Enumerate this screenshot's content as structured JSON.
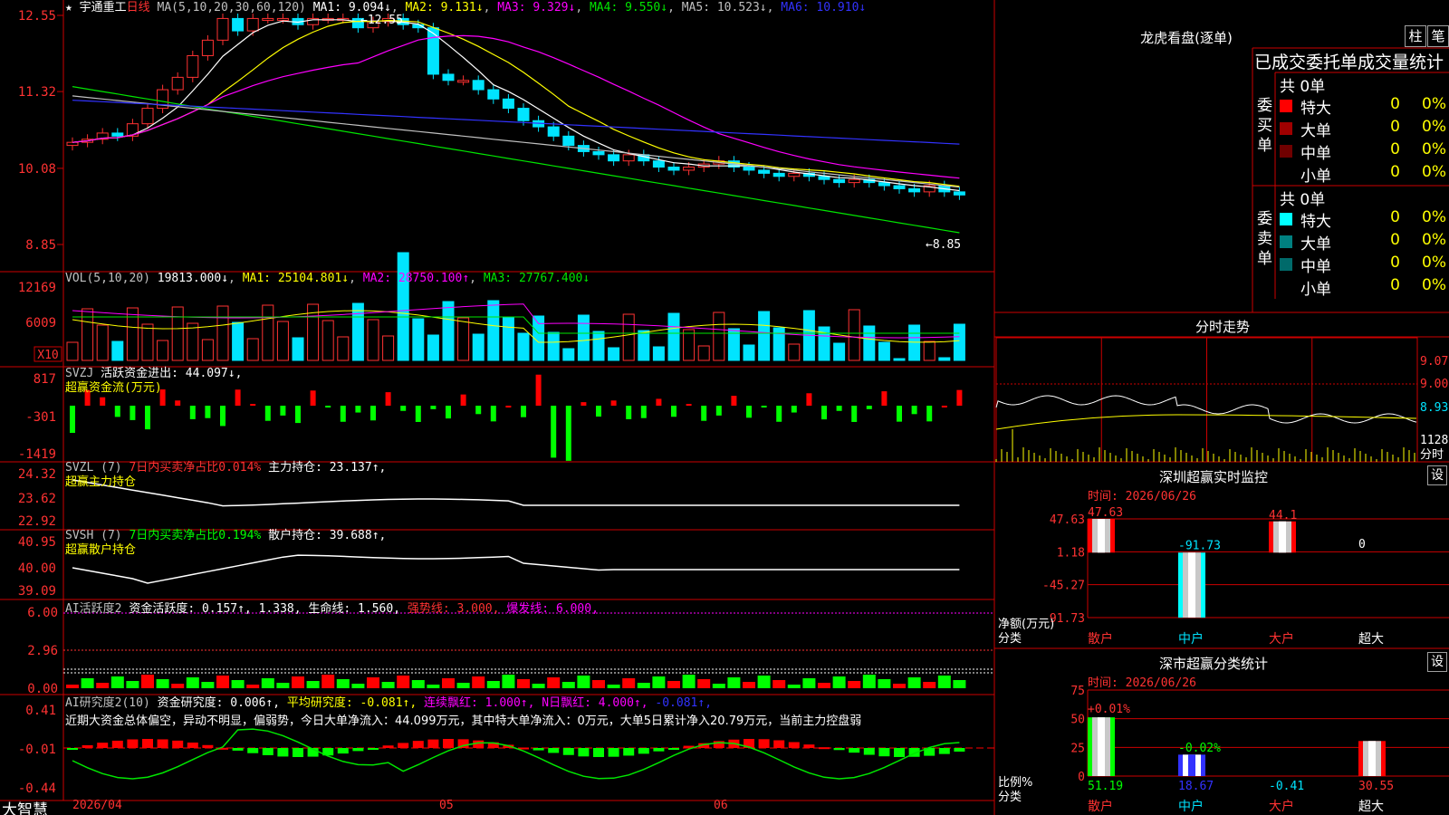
{
  "colors": {
    "up": "#ff3232",
    "down": "#00e4ff",
    "ma1": "#ffffff",
    "ma2": "#ffff00",
    "ma3": "#ff00ff",
    "ma4": "#00e600",
    "ma5": "#c0c0c0",
    "ma6": "#3232ff",
    "grid": "#cc0000",
    "axis": "#ff3232"
  },
  "header": {
    "star": "★",
    "name": "宇通重工",
    "period": "日线",
    "ma_label": "MA(5,10,20,30,60,120)",
    "ma1": "MA1: 9.094↓",
    "ma2": "MA2: 9.131↓",
    "ma3": "MA3: 9.329↓",
    "ma4": "MA4: 9.550↓",
    "ma5": "MA5: 10.523↓",
    "ma6": "MA6: 10.910↓",
    "high_label": "12.55",
    "low_label": "8.85"
  },
  "main_yaxis": [
    "12.55",
    "11.32",
    "10.08",
    "8.85"
  ],
  "vol": {
    "label": "VOL(5,10,20)",
    "value": "19813.000↓",
    "ma1": "MA1: 25104.801↓",
    "ma2": "MA2: 28750.100↑",
    "ma3": "MA3: 27767.400↓",
    "y": [
      "12169",
      "6009"
    ],
    "unit": "X10"
  },
  "svzj": {
    "label": "SVZJ",
    "text": "活跃资金进出: 44.097↓,",
    "sub": "超赢资金流(万元)",
    "y": [
      "817",
      "-301",
      "-1419"
    ]
  },
  "svzl": {
    "label": "SVZL (7)",
    "red": "7日内买卖净占比0.014%",
    "text": "主力持仓: 23.137↑,",
    "sub": "超赢主力持仓",
    "y": [
      "24.32",
      "23.62",
      "22.92"
    ]
  },
  "svsh": {
    "label": "SVSH (7)",
    "green": "7日内买卖净占比0.194%",
    "text": "散户持仓: 39.688↑,",
    "sub": "超赢散户持仓",
    "y": [
      "40.95",
      "40.00",
      "39.09"
    ]
  },
  "ai1": {
    "label": "AI活跃度2",
    "t1": "资金活跃度: 0.157↑,",
    "t2": "1.338,",
    "t3": "生命线: 1.560,",
    "t4": "强势线: 3.000,",
    "t5": "爆发线: 6.000,",
    "y": [
      "6.00",
      "2.96",
      "0.00"
    ]
  },
  "ai2": {
    "label": "AI研究度2(10)",
    "t1": "资金研究度: 0.006↑,",
    "t2": "平均研究度: -0.081↑,",
    "t3": "连续飘红: 1.000↑,",
    "t4": "N日飘红: 4.000↑,",
    "t5": "-0.081↑,",
    "desc": "近期大资金总体偏空，异动不明显，偏弱势，今日大单净流入：44.099万元，其中特大单净流入：0万元，大单5日累计净入20.79万元，当前主力控盘弱",
    "y": [
      "0.41",
      "-0.01",
      "-0.44"
    ]
  },
  "footer": {
    "app": "大智慧",
    "date": "2026/04",
    "m1": "05",
    "m2": "06"
  },
  "longhu": {
    "title": "龙虎看盘(逐单)",
    "btn1": "柱",
    "btn2": "笔",
    "subtitle": "已成交委托单成交量统计",
    "buy": {
      "side": "委买单",
      "total": "共 0单",
      "rows": [
        {
          "name": "特大",
          "val": "0",
          "pct": "0%",
          "color": "#ff0000"
        },
        {
          "name": "大单",
          "val": "0",
          "pct": "0%",
          "color": "#a00000"
        },
        {
          "name": "中单",
          "val": "0",
          "pct": "0%",
          "color": "#700000"
        },
        {
          "name": "小单",
          "val": "0",
          "pct": "0%",
          "color": ""
        }
      ]
    },
    "sell": {
      "side": "委卖单",
      "total": "共 0单",
      "rows": [
        {
          "name": "特大",
          "val": "0",
          "pct": "0%",
          "color": "#00ffff"
        },
        {
          "name": "大单",
          "val": "0",
          "pct": "0%",
          "color": "#008080"
        },
        {
          "name": "中单",
          "val": "0",
          "pct": "0%",
          "color": "#006a6a"
        },
        {
          "name": "小单",
          "val": "0",
          "pct": "0%",
          "color": ""
        }
      ]
    }
  },
  "intraday": {
    "title": "分时走势",
    "y": [
      "9.07",
      "9.00",
      "8.93"
    ],
    "vol": "1128",
    "unit": "分时"
  },
  "monitor": {
    "title": "深圳超赢实时监控",
    "set": "设",
    "time": "时间: 2026/06/26",
    "y": [
      "47.63",
      "1.18",
      "-45.27",
      "-91.73"
    ],
    "labels": [
      "47.63",
      "-91.73",
      "44.1",
      "0"
    ],
    "cats": [
      "散户",
      "中户",
      "大户",
      "超大"
    ],
    "ylabel1": "净额(万元)",
    "ylabel2": "分类"
  },
  "classify": {
    "title": "深市超赢分类统计",
    "set": "设",
    "time": "时间: 2026/06/26",
    "y": [
      "75",
      "50",
      "25",
      "0"
    ],
    "top": [
      "+0.01%",
      "-0.02%"
    ],
    "bottom": [
      "51.19",
      "18.67",
      "-0.41",
      "30.55"
    ],
    "cats": [
      "散户",
      "中户",
      "大户",
      "超大"
    ],
    "ylabel1": "比例%",
    "ylabel2": "分类"
  }
}
